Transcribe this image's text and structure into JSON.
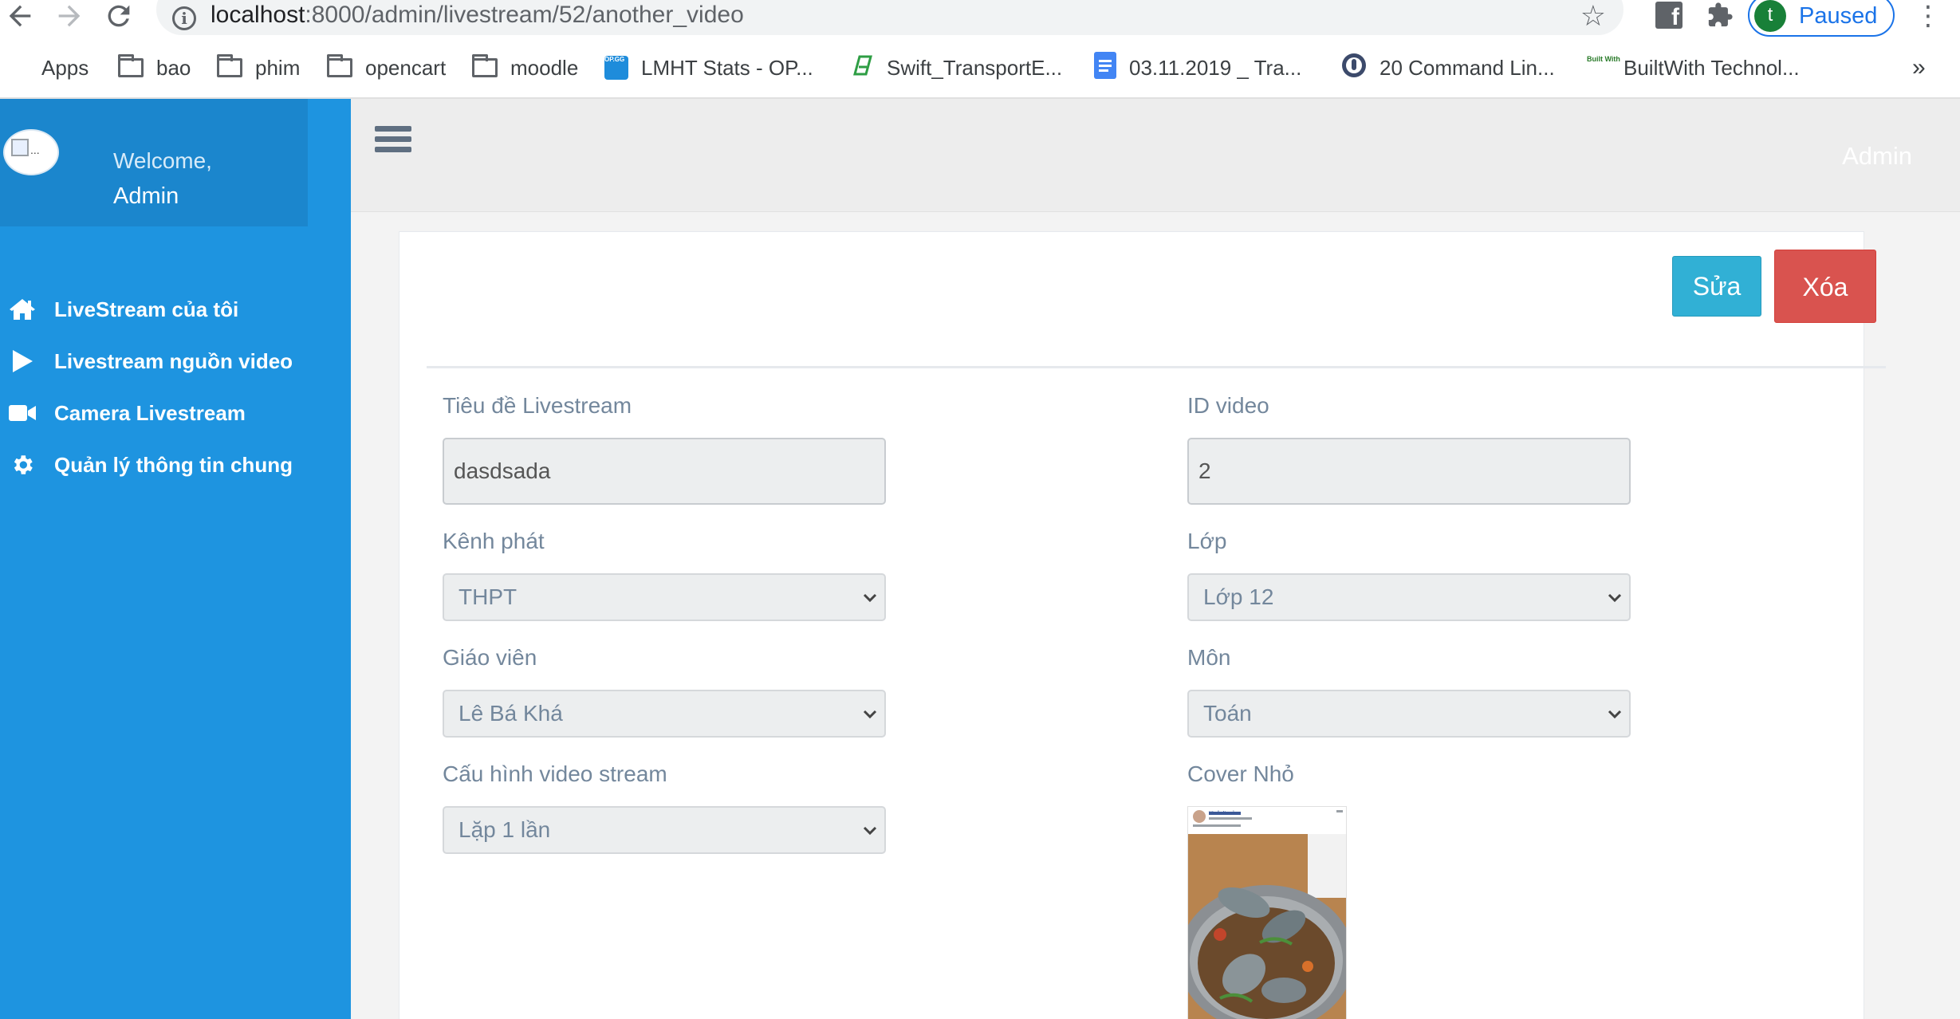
{
  "browser": {
    "url_host": "localhost",
    "url_path": ":8000/admin/livestream/52/another_video",
    "profile_initial": "t",
    "profile_status": "Paused",
    "bookmarks": [
      {
        "label": "Apps",
        "icon": "apps-grid-icon"
      },
      {
        "label": "bao",
        "icon": "folder-icon"
      },
      {
        "label": "phim",
        "icon": "folder-icon"
      },
      {
        "label": "opencart",
        "icon": "folder-icon"
      },
      {
        "label": "moodle",
        "icon": "folder-icon"
      },
      {
        "label": "LMHT Stats - OP...",
        "icon": "opgg-favicon",
        "favicon_text": "OP.GG"
      },
      {
        "label": "Swift_TransportE...",
        "icon": "swift-favicon"
      },
      {
        "label": "03.11.2019 _ Tra...",
        "icon": "google-docs-icon"
      },
      {
        "label": "20 Command Lin...",
        "icon": "command-line-favicon"
      },
      {
        "label": "BuiltWith Technol...",
        "icon": "builtwith-favicon",
        "favicon_text": "Built With"
      }
    ],
    "more_label": "»"
  },
  "sidebar": {
    "welcome": "Welcome,",
    "user": "Admin",
    "avatar_alt": "...",
    "items": [
      {
        "label": "LiveStream của tôi",
        "icon": "home-icon"
      },
      {
        "label": "Livestream nguồn video",
        "icon": "play-icon"
      },
      {
        "label": "Camera Livestream",
        "icon": "video-camera-icon"
      },
      {
        "label": "Quản lý thông tin chung",
        "icon": "gear-icon"
      }
    ]
  },
  "topbar": {
    "user": "Admin"
  },
  "actions": {
    "edit_label": "Sửa",
    "delete_label": "Xóa"
  },
  "form": {
    "title": {
      "label": "Tiêu đề Livestream",
      "value": "dasdsada"
    },
    "video_id": {
      "label": "ID video",
      "value": "2"
    },
    "channel": {
      "label": "Kênh phát",
      "value": "THPT"
    },
    "grade": {
      "label": "Lớp",
      "value": "Lớp 12"
    },
    "teacher": {
      "label": "Giáo viên",
      "value": "Lê Bá Khá"
    },
    "subject": {
      "label": "Môn",
      "value": "Toán"
    },
    "stream_config": {
      "label": "Cấu hình video stream",
      "value": "Lặp 1 lần"
    },
    "cover": {
      "label": "Cover Nhỏ",
      "post_author": "Văn Ăn Nguyễn"
    }
  },
  "colors": {
    "sidebar": "#1e94e0",
    "edit_button": "#31b0d5",
    "delete_button": "#d9534f"
  }
}
